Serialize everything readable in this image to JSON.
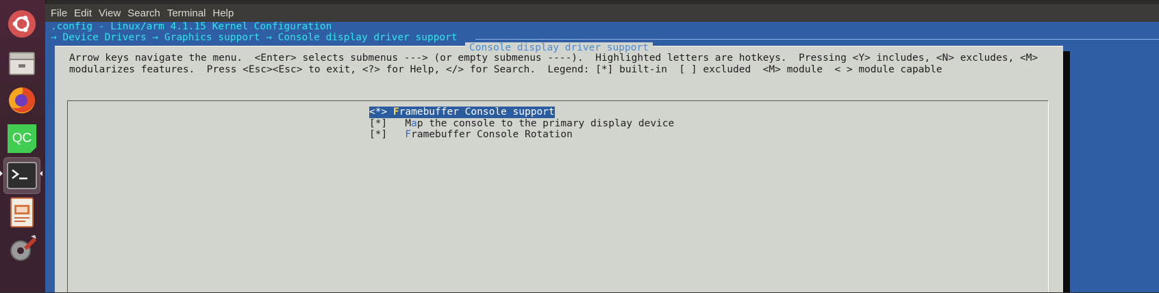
{
  "window": {
    "title_strip": ""
  },
  "menubar": {
    "items": [
      "File",
      "Edit",
      "View",
      "Search",
      "Terminal",
      "Help"
    ]
  },
  "launcher": {
    "items": [
      {
        "name": "ubuntu-dash-icon"
      },
      {
        "name": "file-manager-icon"
      },
      {
        "name": "firefox-icon"
      },
      {
        "name": "qt-creator-icon",
        "label": "QC"
      },
      {
        "name": "terminal-icon"
      },
      {
        "name": "impress-icon"
      },
      {
        "name": "system-settings-icon"
      }
    ]
  },
  "terminal": {
    "config_line": ".config - Linux/arm 4.1.15 Kernel Configuration",
    "breadcrumb": "→ Device Drivers → Graphics support → Console display driver support ",
    "breadcrumb_rule": "─"
  },
  "dialog": {
    "title": "Console display driver support",
    "help_line1": "Arrow keys navigate the menu.  <Enter> selects submenus ---> (or empty submenus ----).  Highlighted letters are hotkeys.  Pressing <Y> includes, <N> excludes, <M>",
    "help_line2": "modularizes features.  Press <Esc><Esc> to exit, <?> for Help, </> for Search.  Legend: [*] built-in  [ ] excluded  <M> module  < > module capable"
  },
  "menu": {
    "items": [
      {
        "prefix": "<*> ",
        "hotkey": "F",
        "rest": "ramebuffer Console support",
        "selected": true
      },
      {
        "prefix": "[*]   ",
        "pre": "M",
        "hotkey": "a",
        "rest": "p the console to the primary display device",
        "selected": false
      },
      {
        "prefix": "[*]   ",
        "hotkey": "F",
        "rest": "ramebuffer Console Rotation",
        "selected": false
      }
    ]
  },
  "colors": {
    "terminal_bg": "#2f5ea5",
    "dialog_bg": "#d2d4ce",
    "selection_bg": "#2b5ca0",
    "hotkey": "#ffd84a",
    "launcher_bg": "#3d2330"
  }
}
